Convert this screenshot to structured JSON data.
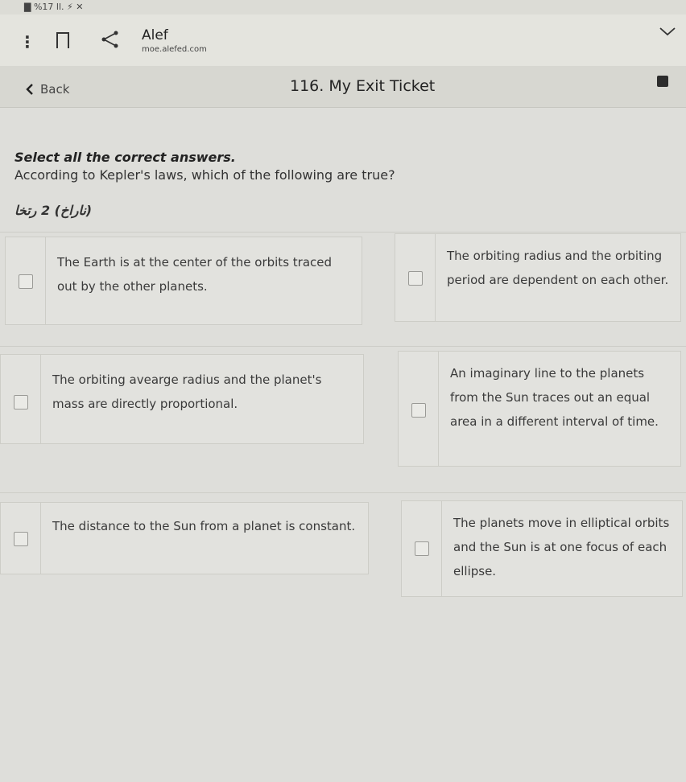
{
  "status_bar": {
    "text": "▇ %17 ll. ⚡ ✕"
  },
  "browser": {
    "site_title": "Alef",
    "site_url": "moe.alefed.com"
  },
  "header": {
    "back_label": "Back",
    "page_title": "116. My Exit Ticket"
  },
  "question": {
    "instruction": "Select all the correct answers.",
    "prompt": "According to Kepler's laws, which of the following are true?",
    "hint": "(ناراخ) 2 رتخا"
  },
  "options": [
    {
      "text": "The Earth is at the center of the orbits traced out by the other planets.",
      "checked": false
    },
    {
      "text": "The orbiting radius and the orbiting period are dependent on each other.",
      "checked": false
    },
    {
      "text": "The orbiting avearge radius and the planet's mass are directly proportional.",
      "checked": false
    },
    {
      "text": "An imaginary line to the planets from the Sun traces out an equal area in a different interval of time.",
      "checked": false
    },
    {
      "text": "The distance to the Sun from a planet is constant.",
      "checked": false
    },
    {
      "text": "The planets move in elliptical orbits and the Sun is at one focus of each ellipse.",
      "checked": false
    }
  ]
}
